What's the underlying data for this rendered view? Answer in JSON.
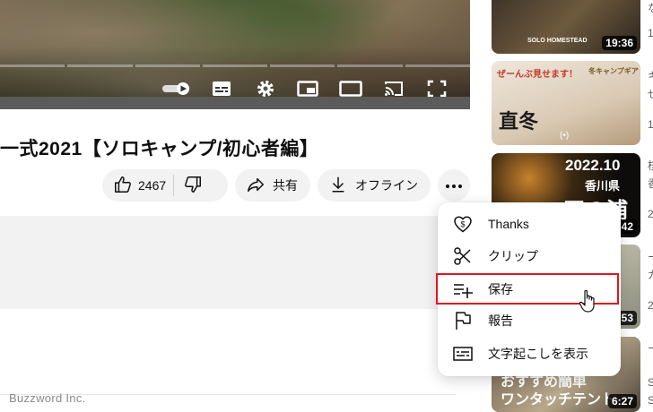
{
  "video": {
    "title": "一式2021【ソロキャンプ/初心者編】",
    "like_count": "2467",
    "share_label": "共有",
    "offline_label": "オフライン"
  },
  "menu": {
    "items": [
      {
        "label": "Thanks",
        "icon": "thanks-heart-icon"
      },
      {
        "label": "クリップ",
        "icon": "scissors-icon"
      },
      {
        "label": "保存",
        "icon": "playlist-add-icon",
        "highlighted": true
      },
      {
        "label": "報告",
        "icon": "flag-icon"
      },
      {
        "label": "文字起こしを表示",
        "icon": "transcript-icon"
      }
    ]
  },
  "sidebar": {
    "thumbnails": [
      {
        "duration": "19:36",
        "text": "SOLO HOMESTEAD"
      },
      {
        "text_top": "ぜーんぶ見せます！",
        "text_main": "直冬",
        "text_sub": "冬キャンプギア"
      },
      {
        "text_top": "2022.10",
        "text_mid": "香川県",
        "text_main": "田の浦",
        "duration": "42"
      },
      {
        "duration": "53"
      },
      {
        "text_top": "おすすめ",
        "text_main": "簡単",
        "text_sub": "ワンタッチテント",
        "duration": "6:27"
      }
    ],
    "side_chars": [
      "な",
      "1",
      "キ",
      "ぜ",
      "1",
      "核",
      "香",
      "2",
      "ー",
      "ガ",
      "2",
      "ー",
      "S",
      "S"
    ]
  },
  "watermark": "Buzzword Inc.",
  "colors": {
    "highlight": "#e0161e",
    "pill_bg": "#f2f2f2"
  }
}
